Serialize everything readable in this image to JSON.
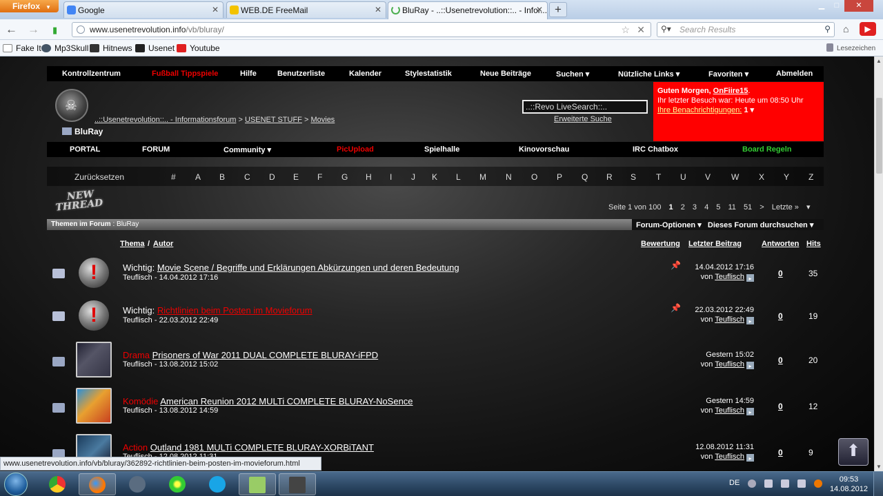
{
  "browser": {
    "menu_button": "Firefox",
    "tabs": [
      {
        "title": "Google"
      },
      {
        "title": "WEB.DE FreeMail"
      },
      {
        "title": "BluRay - ..::Usenetrevolution::.. - Infor..."
      }
    ],
    "url_domain": "www.usenetrevolution.info",
    "url_path": "/vb/bluray/",
    "search_placeholder": "Search Results",
    "bookmarks": [
      "Fake It",
      "Mp3Skull",
      "Hitnews",
      "Usenet",
      "Youtube"
    ],
    "bookmark_extra": "Lesezeichen",
    "status_url": "www.usenetrevolution.info/vb/bluray/362892-richtlinien-beim-posten-im-movieforum.html"
  },
  "forum": {
    "top_nav": [
      "Kontrollzentrum",
      "Fußball Tippspiele",
      "Hilfe",
      "Benutzerliste",
      "Kalender",
      "Stylestatistik",
      "Neue Beiträge",
      "Suchen ▾",
      "Nützliche Links ▾",
      "Favoriten ▾",
      "Abmelden"
    ],
    "breadcrumb": {
      "root": "..::Usenetrevolution::.. - Informationsforum",
      "sep": ">",
      "level1": "USENET STUFF",
      "level2": "Movies"
    },
    "page_title": "BluRay",
    "live_search": "..::Revo LiveSearch::..",
    "advanced_search": "Erweiterte Suche",
    "user": {
      "greeting": "Guten Morgen,",
      "username": "OnFiire15",
      "last_visit": "Ihr letzter Besuch war: Heute um 08:50 Uhr",
      "notifications_label": "Ihre Benachrichtigungen:",
      "notifications_count": "1 ▾"
    },
    "sub_nav": [
      "PORTAL",
      "FORUM",
      "Community ▾",
      "PicUpload",
      "Spielhalle",
      "Kinovorschau",
      "IRC Chatbox",
      "Board Regeln"
    ],
    "alpha_reset": "Zurücksetzen",
    "alpha": [
      "#",
      "A",
      "B",
      "C",
      "D",
      "E",
      "F",
      "G",
      "H",
      "I",
      "J",
      "K",
      "L",
      "M",
      "N",
      "O",
      "P",
      "Q",
      "R",
      "S",
      "T",
      "U",
      "V",
      "W",
      "X",
      "Y",
      "Z"
    ],
    "new_thread_line1": "NEW",
    "new_thread_line2": "THREAD",
    "pager": {
      "label": "Seite 1 von 100",
      "pages": [
        "1",
        "2",
        "3",
        "4",
        "5",
        "11",
        "51",
        ">",
        "Letzte »"
      ],
      "menu": "▾"
    },
    "thread_header": {
      "prefix": "Themen im Forum",
      "forum": ": BluRay"
    },
    "forum_options": "Forum-Optionen ▾",
    "forum_search": "Dieses Forum durchsuchen ▾",
    "columns": {
      "thema": "Thema",
      "sep": "/",
      "autor": "Autor",
      "rating": "Bewertung",
      "last_post": "Letzter Beitrag",
      "replies": "Antworten",
      "hits": "Hits"
    },
    "threads": [
      {
        "prefix": "Wichtig:",
        "title": "Movie Scene / Begriffe und Erklärungen Abkürzungen und deren Bedeutung",
        "author_date": "Teuflisch - 14.04.2012 17:16",
        "last_date": "14.04.2012 17:16",
        "by": "von",
        "last_user": "Teuflisch",
        "replies": "0",
        "hits": "35"
      },
      {
        "prefix": "Wichtig:",
        "title": "Richtlinien beim Posten im Movieforum",
        "author_date": "Teuflisch - 22.03.2012 22:49",
        "last_date": "22.03.2012 22:49",
        "by": "von",
        "last_user": "Teuflisch",
        "replies": "0",
        "hits": "19"
      },
      {
        "prefix": "Drama",
        "title": "Prisoners of War 2011 DUAL COMPLETE BLURAY-iFPD",
        "author_date": "Teuflisch - 13.08.2012 15:02",
        "last_date": "Gestern 15:02",
        "by": "von",
        "last_user": "Teuflisch",
        "replies": "0",
        "hits": "20"
      },
      {
        "prefix": "Komödie",
        "title": "American Reunion 2012 MULTi COMPLETE BLURAY-NoSence",
        "author_date": "Teuflisch - 13.08.2012 14:59",
        "last_date": "Gestern 14:59",
        "by": "von",
        "last_user": "Teuflisch",
        "replies": "0",
        "hits": "12"
      },
      {
        "prefix": "Action",
        "title": "Outland 1981 MULTi COMPLETE BLURAY-XORBiTANT",
        "author_date": "Teuflisch - 12.08.2012 11:31",
        "last_date": "12.08.2012 11:31",
        "by": "von",
        "last_user": "Teuflisch",
        "replies": "0",
        "hits": "9"
      }
    ]
  },
  "taskbar": {
    "lang": "DE",
    "time": "09:53",
    "date": "14.08.2012"
  },
  "colors": {
    "accent_red": "#ff0000",
    "genre_red": "#e00000",
    "board_rules_green": "#33cc33"
  }
}
